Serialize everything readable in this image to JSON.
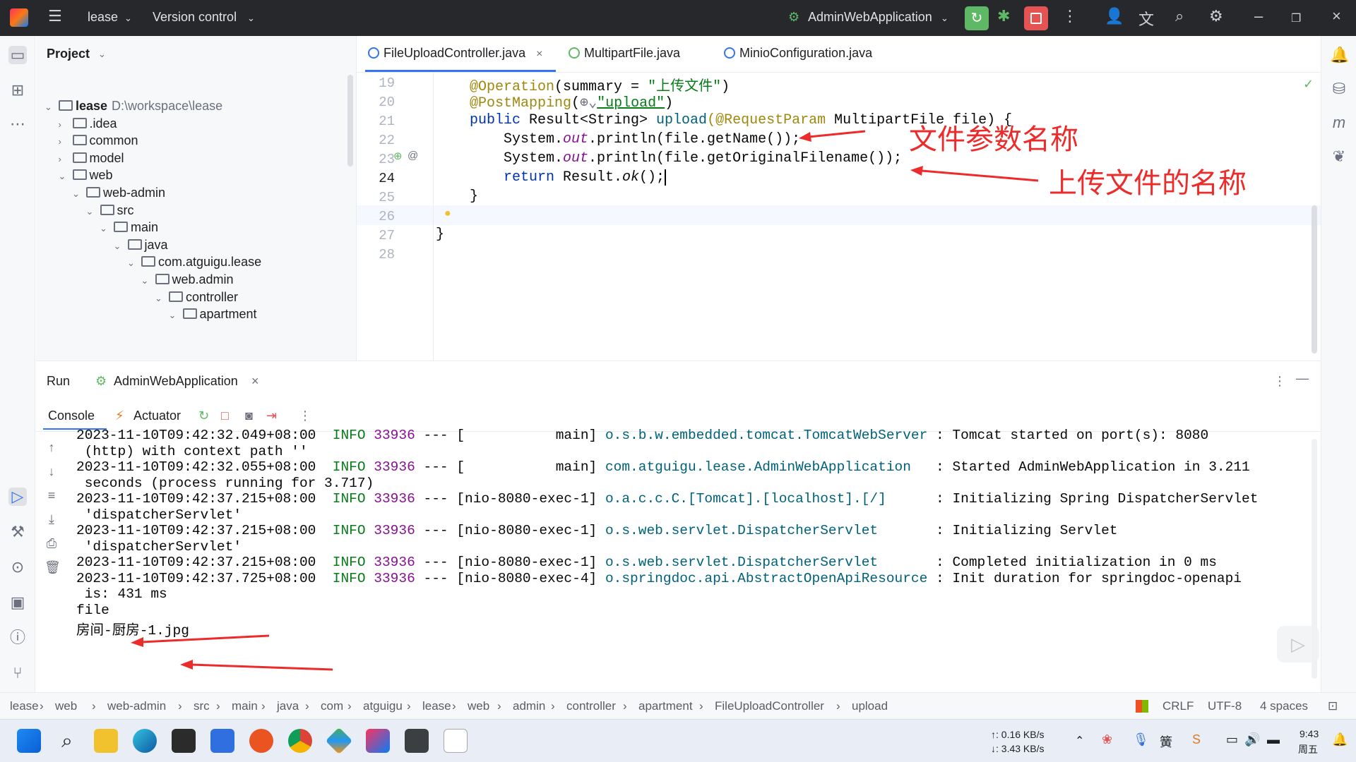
{
  "titlebar": {
    "project_name": "lease",
    "vcs": "Version control",
    "run_config": "AdminWebApplication"
  },
  "project_panel": {
    "title": "Project",
    "tree": [
      {
        "label": "lease",
        "path": "D:\\workspace\\lease",
        "indent": 0,
        "expanded": true
      },
      {
        "label": ".idea",
        "indent": 1,
        "expanded": false
      },
      {
        "label": "common",
        "indent": 1,
        "expanded": false
      },
      {
        "label": "model",
        "indent": 1,
        "expanded": false
      },
      {
        "label": "web",
        "indent": 1,
        "expanded": true
      },
      {
        "label": "web-admin",
        "indent": 2,
        "expanded": true
      },
      {
        "label": "src",
        "indent": 3,
        "expanded": true
      },
      {
        "label": "main",
        "indent": 4,
        "expanded": true
      },
      {
        "label": "java",
        "indent": 5,
        "expanded": true
      },
      {
        "label": "com.atguigu.lease",
        "indent": 6,
        "expanded": true
      },
      {
        "label": "web.admin",
        "indent": 7,
        "expanded": true
      },
      {
        "label": "controller",
        "indent": 8,
        "expanded": true
      },
      {
        "label": "apartment",
        "indent": 9,
        "expanded": true
      }
    ]
  },
  "editor": {
    "tabs": [
      {
        "label": "FileUploadController.java",
        "active": true
      },
      {
        "label": "MultipartFile.java",
        "active": false
      },
      {
        "label": "MinioConfiguration.java",
        "active": false
      }
    ],
    "line_numbers": [
      "19",
      "20",
      "21",
      "22",
      "23",
      "24",
      "25",
      "26",
      "27",
      "28"
    ],
    "lines": {
      "l19_ann": "@Operation",
      "l19_rest": "(summary = ",
      "l19_str": "\"上传文件\"",
      "l19_end": ")",
      "l20_ann": "@PostMapping",
      "l20_rest": "(",
      "l20_str": "\"upload\"",
      "l20_end": ")",
      "l21_kw": "public ",
      "l21_type": "Result<String> ",
      "l21_mth": "upload",
      "l21_ann": "(@RequestParam ",
      "l21_rest": "MultipartFile file) {",
      "l22_a": "System.",
      "l22_it": "out",
      "l22_b": ".println(file.getName());",
      "l23_a": "System.",
      "l23_it": "out",
      "l23_b": ".println(file.getOriginalFilename());",
      "l24_kw": "return ",
      "l24_b": "Result.",
      "l24_it": "ok",
      "l24_c": "();",
      "l25": "}",
      "l27": "}"
    },
    "notes": {
      "note1": "文件参数名称",
      "note2": "上传文件的名称"
    }
  },
  "run_panel": {
    "run_label": "Run",
    "app_tab": "AdminWebApplication",
    "console_tab": "Console",
    "actuator_tab": "Actuator",
    "log_lines": [
      {
        "ts": "2023-11-10T09:42:32.049+08:00",
        "level": "INFO",
        "pid": "33936",
        "sep": "---",
        "thread": "[           main]",
        "cls": "o.s.b.w.embedded.tomcat.TomcatWebServer",
        "msg": ": Tomcat started on port(s): 8080"
      },
      {
        "cont": "(http) with context path ''"
      },
      {
        "ts": "2023-11-10T09:42:32.055+08:00",
        "level": "INFO",
        "pid": "33936",
        "sep": "---",
        "thread": "[           main]",
        "cls": "com.atguigu.lease.AdminWebApplication",
        "msg": ": Started AdminWebApplication in 3.211"
      },
      {
        "cont": "seconds (process running for 3.717)"
      },
      {
        "ts": "2023-11-10T09:42:37.215+08:00",
        "level": "INFO",
        "pid": "33936",
        "sep": "---",
        "thread": "[nio-8080-exec-1]",
        "cls": "o.a.c.c.C.[Tomcat].[localhost].[/]",
        "msg": ": Initializing Spring DispatcherServlet"
      },
      {
        "cont": "'dispatcherServlet'"
      },
      {
        "ts": "2023-11-10T09:42:37.215+08:00",
        "level": "INFO",
        "pid": "33936",
        "sep": "---",
        "thread": "[nio-8080-exec-1]",
        "cls": "o.s.web.servlet.DispatcherServlet",
        "msg": ": Initializing Servlet"
      },
      {
        "cont": "'dispatcherServlet'"
      },
      {
        "ts": "2023-11-10T09:42:37.215+08:00",
        "level": "INFO",
        "pid": "33936",
        "sep": "---",
        "thread": "[nio-8080-exec-1]",
        "cls": "o.s.web.servlet.DispatcherServlet",
        "msg": ": Completed initialization in 0 ms"
      },
      {
        "ts": "2023-11-10T09:42:37.725+08:00",
        "level": "INFO",
        "pid": "33936",
        "sep": "---",
        "thread": "[nio-8080-exec-4]",
        "cls": "o.springdoc.api.AbstractOpenApiResource",
        "msg": ": Init duration for springdoc-openapi"
      },
      {
        "cont": "is: 431 ms"
      },
      {
        "plain": "file"
      },
      {
        "plain": "房间-厨房-1.jpg"
      }
    ]
  },
  "statusbar": {
    "crumbs": [
      "lease",
      "web",
      "web-admin",
      "src",
      "main",
      "java",
      "com",
      "atguigu",
      "lease",
      "web",
      "admin",
      "controller",
      "apartment",
      "FileUploadController",
      "upload"
    ],
    "line_sep": "CRLF",
    "encoding": "UTF-8",
    "indent": "4 spaces"
  },
  "taskbar": {
    "net_up": "↑: 0.16 KB/s",
    "net_down": "↓: 3.43 KB/s",
    "time": "9:43",
    "weekday": "周五"
  },
  "colors": {
    "accent": "#3574f0",
    "titlebar_bg": "#27282c",
    "annotation_red": "#ec2b2b",
    "run_green": "#5fb865",
    "stop_red": "#e55353"
  }
}
